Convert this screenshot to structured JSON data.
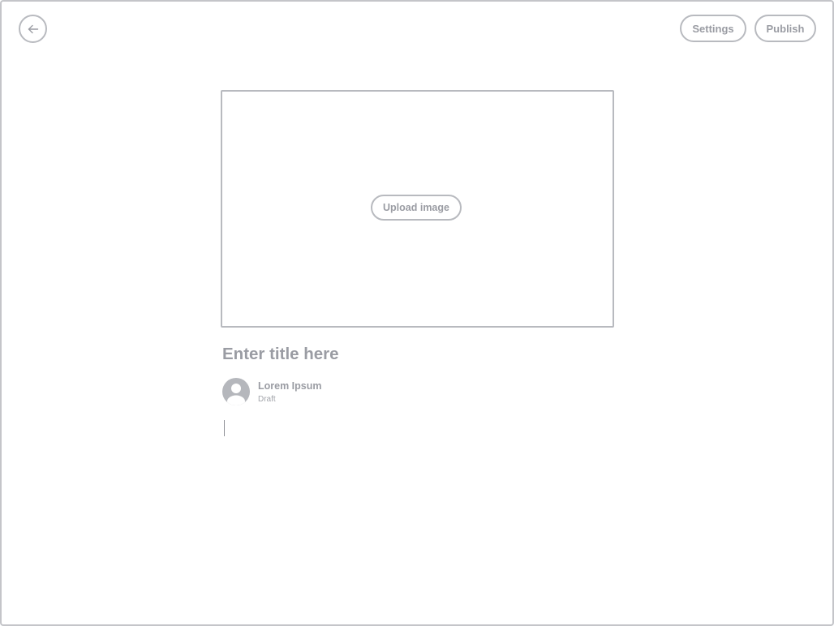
{
  "header": {
    "back_icon": "arrow-left-icon",
    "settings_label": "Settings",
    "publish_label": "Publish"
  },
  "cover": {
    "upload_label": "Upload image"
  },
  "post": {
    "title_placeholder": "Enter title here",
    "title_value": "",
    "body_value": ""
  },
  "author": {
    "name": "Lorem Ipsum",
    "status": "Draft",
    "avatar_icon": "user-avatar-icon"
  },
  "colors": {
    "outline": "#b8babf",
    "text": "#9a9ca3",
    "avatar_fill": "#b5b7bc"
  }
}
